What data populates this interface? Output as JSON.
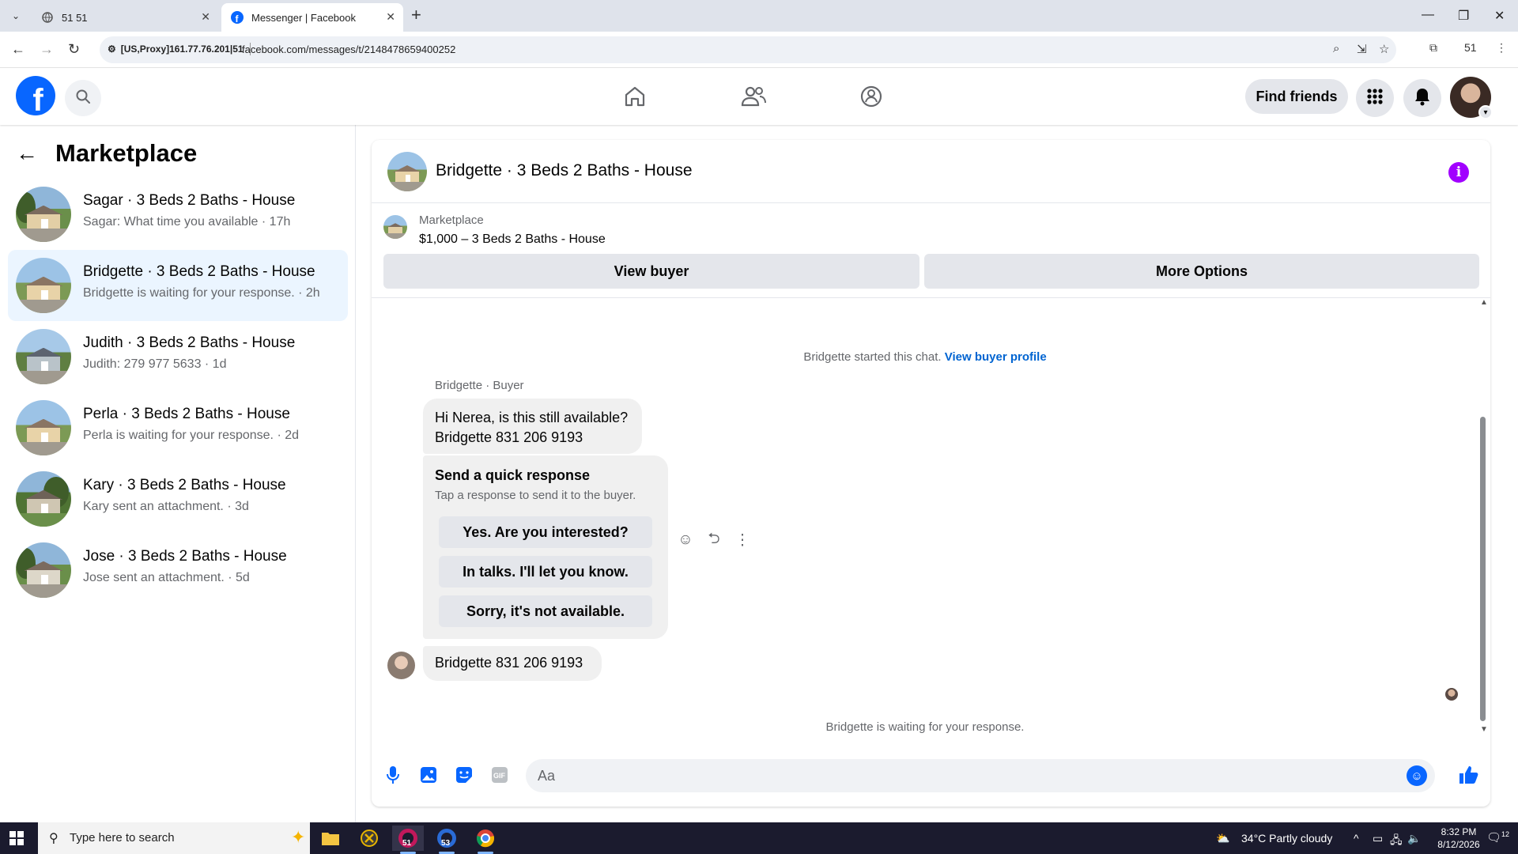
{
  "browser": {
    "tabs": [
      {
        "title": "51 51",
        "icon": "globe-icon"
      },
      {
        "title": "Messenger | Facebook",
        "icon": "facebook-icon"
      }
    ],
    "proxy_label": "[US,Proxy]161.77.76.201|51",
    "url": "facebook.com/messages/t/2148478659400252",
    "profile_badge": "51"
  },
  "header": {
    "logo_letter": "f",
    "find_friends_label": "Find friends"
  },
  "sidebar": {
    "title": "Marketplace",
    "conversations": [
      {
        "title": "Sagar · 3 Beds 2 Baths - House",
        "subtitle": "Sagar: What time you available · 17h"
      },
      {
        "title": "Bridgette · 3 Beds 2 Baths - House",
        "subtitle": "Bridgette is waiting for your response. · 2h"
      },
      {
        "title": "Judith · 3 Beds 2 Baths - House",
        "subtitle": "Judith: 279 977 5633 · 1d"
      },
      {
        "title": "Perla · 3 Beds 2 Baths - House",
        "subtitle": "Perla is waiting for your response. · 2d"
      },
      {
        "title": "Kary · 3 Beds 2 Baths - House",
        "subtitle": "Kary sent an attachment. · 3d"
      },
      {
        "title": "Jose · 3 Beds 2 Baths - House",
        "subtitle": "Jose sent an attachment. · 5d"
      }
    ]
  },
  "chat": {
    "title": "Bridgette · 3 Beds 2 Baths - House",
    "info_icon_label": "i",
    "marketplace_label": "Marketplace",
    "listing": "$1,000 – 3 Beds 2 Baths - House",
    "view_buyer_label": "View buyer",
    "more_options_label": "More Options",
    "started_text": "Bridgette started this chat.",
    "view_buyer_profile_label": "View buyer profile",
    "sender_label": "Bridgette · Buyer",
    "message_1_line1": "Hi Nerea, is this still available?",
    "message_1_line2": "Bridgette  831 206 9193",
    "quick_response_title": "Send a quick response",
    "quick_response_subtitle": "Tap a response to send it to the buyer.",
    "quick_responses": [
      "Yes. Are you interested?",
      "In talks. I'll let you know.",
      "Sorry, it's not available."
    ],
    "message_2": "Bridgette  831 206 9193",
    "waiting_text": "Bridgette is waiting for your response.",
    "composer_placeholder": "Aa",
    "composer_gif_label": "GIF"
  },
  "taskbar": {
    "search_placeholder": "Type here to search",
    "apps": [
      {
        "name": "file-explorer-icon",
        "label": ""
      },
      {
        "name": "app-x-icon",
        "label": ""
      },
      {
        "name": "browser-51-icon",
        "label": "51"
      },
      {
        "name": "browser-53-icon",
        "label": "53"
      },
      {
        "name": "chrome-icon",
        "label": ""
      }
    ],
    "weather": "34°C  Partly cloudy",
    "time": "8:32 PM",
    "date": "8/12/2026",
    "notification_count": "12"
  },
  "colors": {
    "fb_blue": "#0866ff",
    "link_blue": "#0064d1",
    "active_conv_bg": "#ebf5ff",
    "info_purple": "#a100ff"
  }
}
